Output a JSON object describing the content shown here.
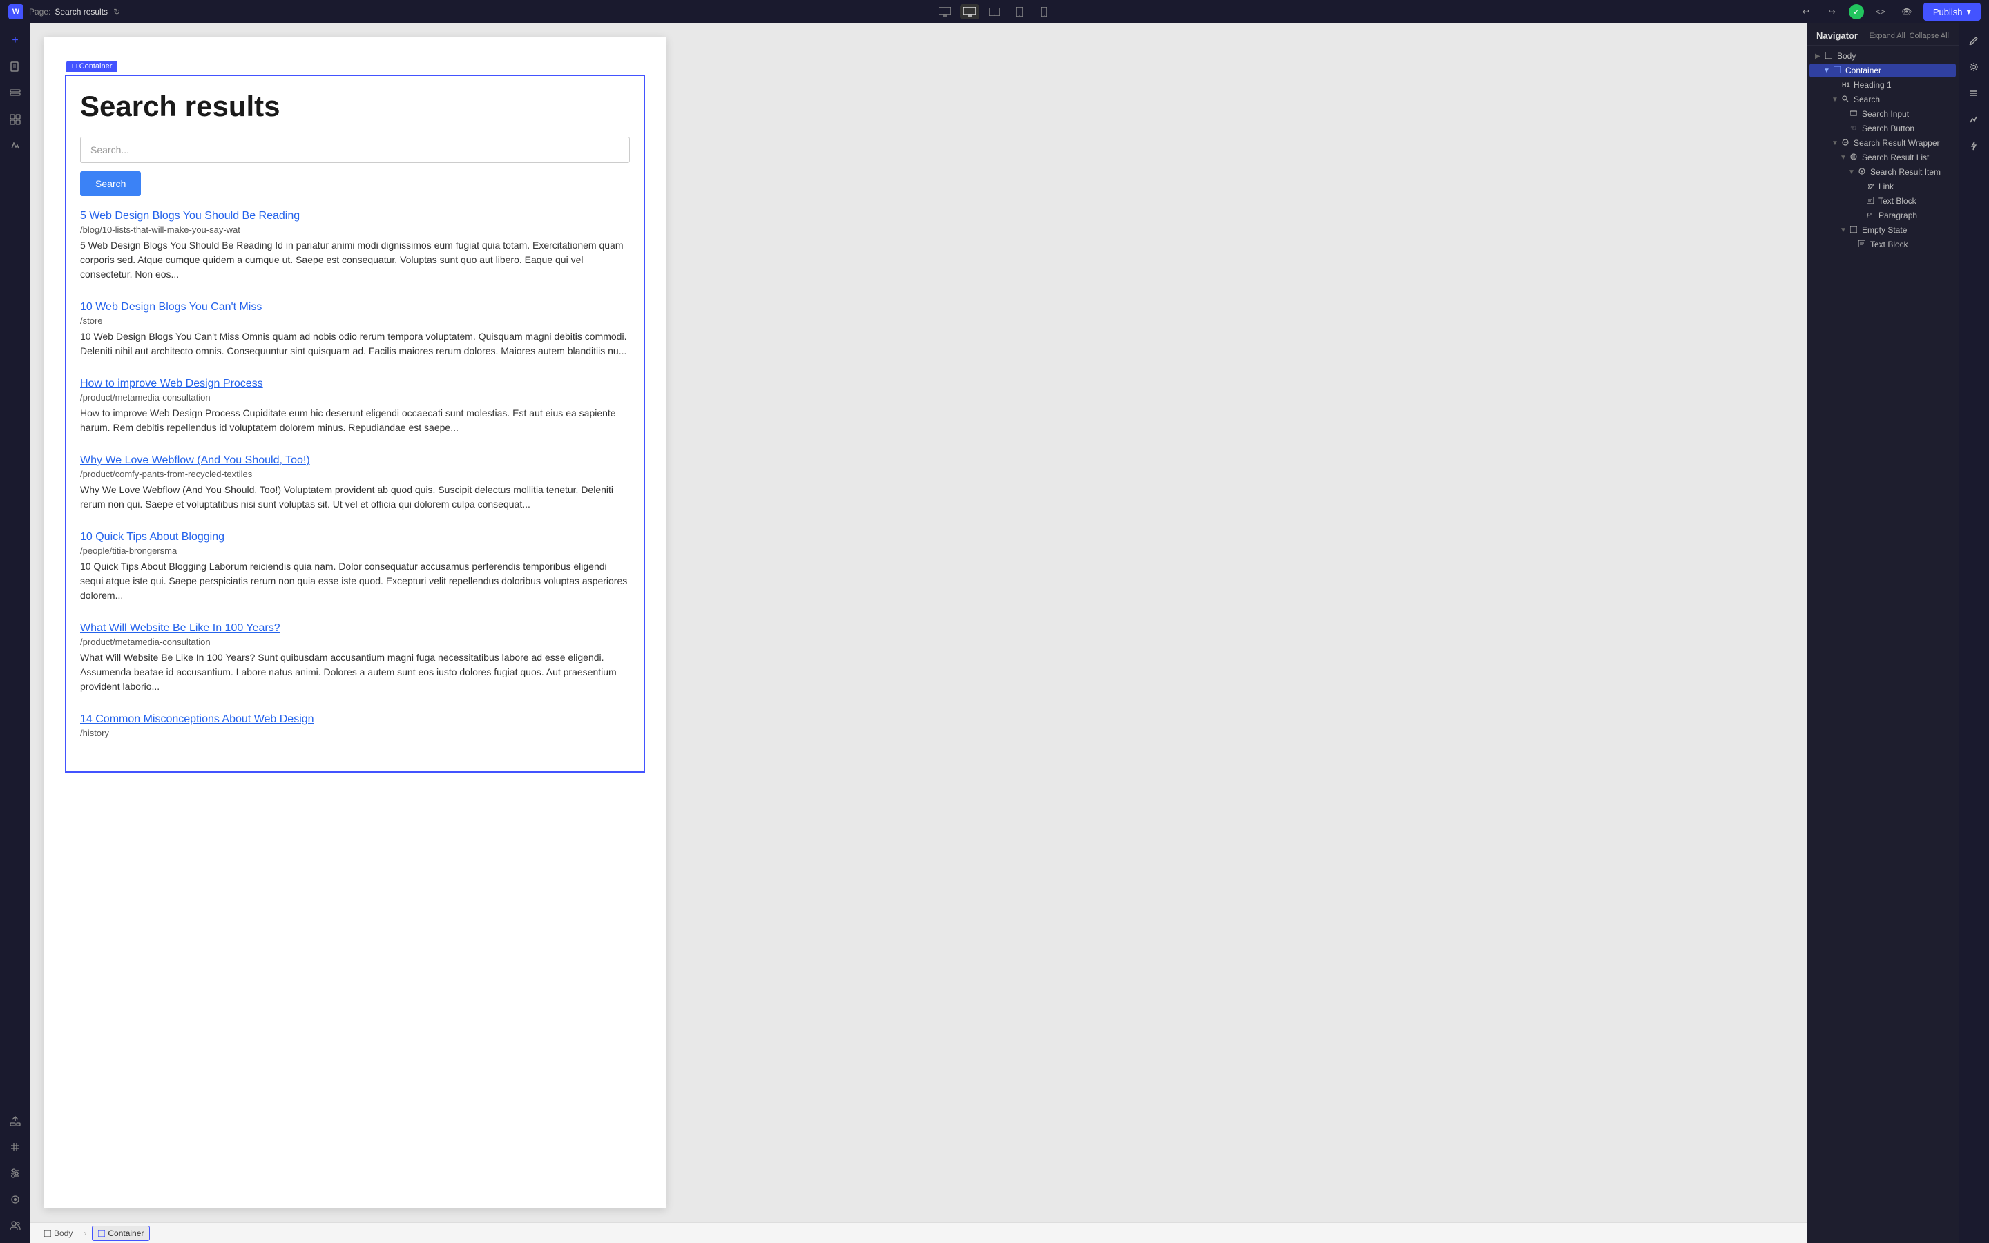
{
  "topbar": {
    "logo": "W",
    "page_label": "Page:",
    "page_name": "Search results",
    "publish_label": "Publish",
    "views": [
      {
        "id": "desktop-xl",
        "label": "Desktop XL",
        "active": false
      },
      {
        "id": "desktop",
        "label": "Desktop",
        "active": true
      },
      {
        "id": "tablet-landscape",
        "label": "Tablet Landscape",
        "active": false
      },
      {
        "id": "tablet-portrait",
        "label": "Tablet Portrait",
        "active": false
      },
      {
        "id": "mobile",
        "label": "Mobile",
        "active": false
      }
    ]
  },
  "canvas": {
    "container_label": "Container",
    "page_title": "Search results",
    "search_placeholder": "Search...",
    "search_button_label": "Search",
    "results": [
      {
        "title": "5 Web Design Blogs You Should Be Reading",
        "url": "/blog/10-lists-that-will-make-you-say-wat",
        "desc": "5 Web Design Blogs You Should Be Reading Id in pariatur animi modi dignissimos eum fugiat quia totam. Exercitationem quam corporis sed. Atque cumque quidem a cumque ut. Saepe est consequatur. Voluptas sunt quo aut libero. Eaque qui vel consectetur. Non eos..."
      },
      {
        "title": "10 Web Design Blogs You Can't Miss",
        "url": "/store",
        "desc": "10 Web Design Blogs You Can't Miss Omnis quam ad nobis odio rerum tempora voluptatem. Quisquam magni debitis commodi. Deleniti nihil aut architecto omnis. Consequuntur sint quisquam ad. Facilis maiores rerum dolores. Maiores autem blanditiis nu..."
      },
      {
        "title": "How to improve Web Design Process",
        "url": "/product/metamedia-consultation",
        "desc": "How to improve Web Design Process Cupiditate eum hic deserunt eligendi occaecati sunt molestias. Est aut eius ea sapiente harum. Rem debitis repellendus id voluptatem dolorem minus. Repudiandae est saepe..."
      },
      {
        "title": "Why We Love Webflow (And You Should, Too!)",
        "url": "/product/comfy-pants-from-recycled-textiles",
        "desc": "Why We Love Webflow (And You Should, Too!) Voluptatem provident ab quod quis. Suscipit delectus mollitia tenetur. Deleniti rerum non qui. Saepe et voluptatibus nisi sunt voluptas sit. Ut vel et officia qui dolorem culpa consequat..."
      },
      {
        "title": "10 Quick Tips About Blogging",
        "url": "/people/titia-brongersma",
        "desc": "10 Quick Tips About Blogging Laborum reiciendis quia nam. Dolor consequatur accusamus perferendis temporibus eligendi sequi atque iste qui. Saepe perspiciatis rerum non quia esse iste quod. Excepturi velit repellendus doloribus voluptas asperiores dolorem..."
      },
      {
        "title": "What Will Website Be Like In 100 Years?",
        "url": "/product/metamedia-consultation",
        "desc": "What Will Website Be Like In 100 Years? Sunt quibusdam accusantium magni fuga necessitatibus labore ad esse eligendi. Assumenda beatae id accusantium. Labore natus animi. Dolores a autem sunt eos iusto dolores fugiat quos. Aut praesentium provident laborio..."
      },
      {
        "title": "14 Common Misconceptions About Web Design",
        "url": "/history",
        "desc": ""
      }
    ]
  },
  "navigator": {
    "title": "Navigator",
    "expand_all": "Expand All",
    "collapse_all": "Collapse All",
    "tree": [
      {
        "id": "body",
        "label": "Body",
        "indent": 0,
        "icon": "□",
        "chevron": "▶",
        "selected": false
      },
      {
        "id": "container",
        "label": "Container",
        "indent": 1,
        "icon": "□",
        "chevron": "▼",
        "selected": true
      },
      {
        "id": "heading1",
        "label": "Heading 1",
        "indent": 2,
        "icon": "H1",
        "chevron": "",
        "selected": false
      },
      {
        "id": "search",
        "label": "Search",
        "indent": 2,
        "icon": "⊙",
        "chevron": "▼",
        "selected": false
      },
      {
        "id": "search-input",
        "label": "Search Input",
        "indent": 3,
        "icon": "□",
        "chevron": "",
        "selected": false
      },
      {
        "id": "search-button",
        "label": "Search Button",
        "indent": 3,
        "icon": "☜",
        "chevron": "",
        "selected": false
      },
      {
        "id": "search-result-wrapper",
        "label": "Search Result Wrapper",
        "indent": 2,
        "icon": "⊙",
        "chevron": "▼",
        "selected": false
      },
      {
        "id": "search-result-list",
        "label": "Search Result List",
        "indent": 3,
        "icon": "⊙",
        "chevron": "▼",
        "selected": false
      },
      {
        "id": "search-result-item",
        "label": "Search Result Item",
        "indent": 4,
        "icon": "⊙",
        "chevron": "▼",
        "selected": false
      },
      {
        "id": "link",
        "label": "Link",
        "indent": 5,
        "icon": "⛓",
        "chevron": "",
        "selected": false
      },
      {
        "id": "text-block",
        "label": "Text Block",
        "indent": 5,
        "icon": "□",
        "chevron": "",
        "selected": false
      },
      {
        "id": "paragraph",
        "label": "Paragraph",
        "indent": 5,
        "icon": "P",
        "chevron": "",
        "selected": false
      },
      {
        "id": "empty-state",
        "label": "Empty State",
        "indent": 3,
        "icon": "□",
        "chevron": "▼",
        "selected": false
      },
      {
        "id": "text-block-2",
        "label": "Text Block",
        "indent": 4,
        "icon": "□",
        "chevron": "",
        "selected": false
      }
    ]
  },
  "breadcrumbs": [
    {
      "label": "Body",
      "icon": "□",
      "active": false
    },
    {
      "label": "Container",
      "icon": "□",
      "active": true
    }
  ],
  "icons": {
    "undo": "↩",
    "redo": "↪",
    "pencil": "✏",
    "gear": "⚙",
    "menu": "☰",
    "chart": "📊",
    "bolt": "⚡",
    "add": "+",
    "pages": "📄",
    "cms": "🗃",
    "assets": "🖼",
    "styles": "🎨",
    "components": "◻",
    "users": "👥",
    "select": "↖",
    "grid": "⊞",
    "sliders": "≡",
    "plugin": "🔌"
  }
}
